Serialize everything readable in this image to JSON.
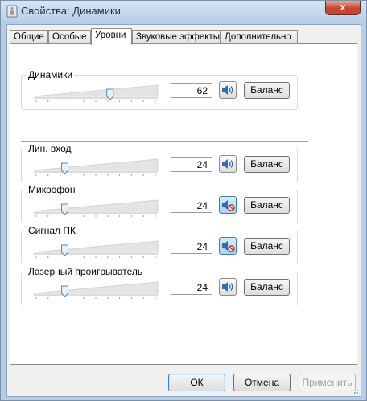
{
  "window": {
    "title": "Свойства: Динамики",
    "close_label": "x"
  },
  "tabs": [
    {
      "label": "Общие",
      "active": false
    },
    {
      "label": "Особые",
      "active": false
    },
    {
      "label": "Уровни",
      "active": true
    },
    {
      "label": "Звуковые эффекты",
      "active": false
    },
    {
      "label": "Дополнительно",
      "active": false
    }
  ],
  "main": {
    "label": "Динамики",
    "value": "62",
    "level_percent": 62,
    "muted": false,
    "balance_label": "Баланс"
  },
  "channels": [
    {
      "label": "Лин. вход",
      "value": "24",
      "level_percent": 24,
      "muted": false,
      "balance_label": "Баланс"
    },
    {
      "label": "Микрофон",
      "value": "24",
      "level_percent": 24,
      "muted": true,
      "balance_label": "Баланс"
    },
    {
      "label": "Сигнал ПК",
      "value": "24",
      "level_percent": 24,
      "muted": true,
      "balance_label": "Баланс"
    },
    {
      "label": "Лазерный проигрыватель",
      "value": "24",
      "level_percent": 24,
      "muted": false,
      "balance_label": "Баланс"
    }
  ],
  "footer": {
    "ok": "ОК",
    "cancel": "Отмена",
    "apply": "Применить"
  },
  "colors": {
    "accent": "#3c7fb1",
    "speaker_blue": "#2f6db5",
    "mute_red": "#d0302a"
  }
}
